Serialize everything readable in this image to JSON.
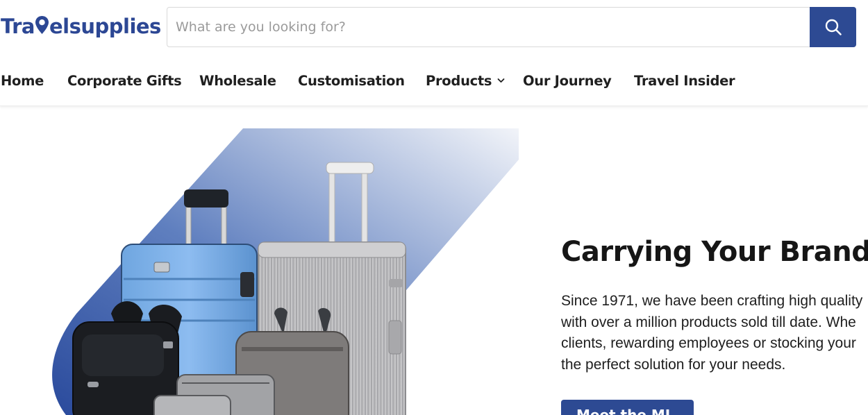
{
  "brand": {
    "logo_prefix": "Tra",
    "logo_suffix": "elsupplies",
    "accent_color": "#2d4a93"
  },
  "search": {
    "placeholder": "What are you looking for?",
    "value": "",
    "button_icon": "search-icon"
  },
  "nav": {
    "items": [
      {
        "label": "Home"
      },
      {
        "label": "Corporate Gifts"
      },
      {
        "label": "Wholesale"
      },
      {
        "label": "Customisation"
      },
      {
        "label": "Products",
        "icon": "chevron-down-icon"
      },
      {
        "label": "Our Journey"
      },
      {
        "label": "Travel Insider"
      }
    ]
  },
  "hero": {
    "title": "Carrying Your Brand Fu",
    "description_lines": [
      "Since 1971, we have been crafting high quality",
      "with over a million products sold till date. Whe",
      "clients, rewarding employees or stocking your",
      "the perfect solution for your needs."
    ],
    "cta_label": "Meet the ML",
    "image": "luggage-collection-image"
  }
}
